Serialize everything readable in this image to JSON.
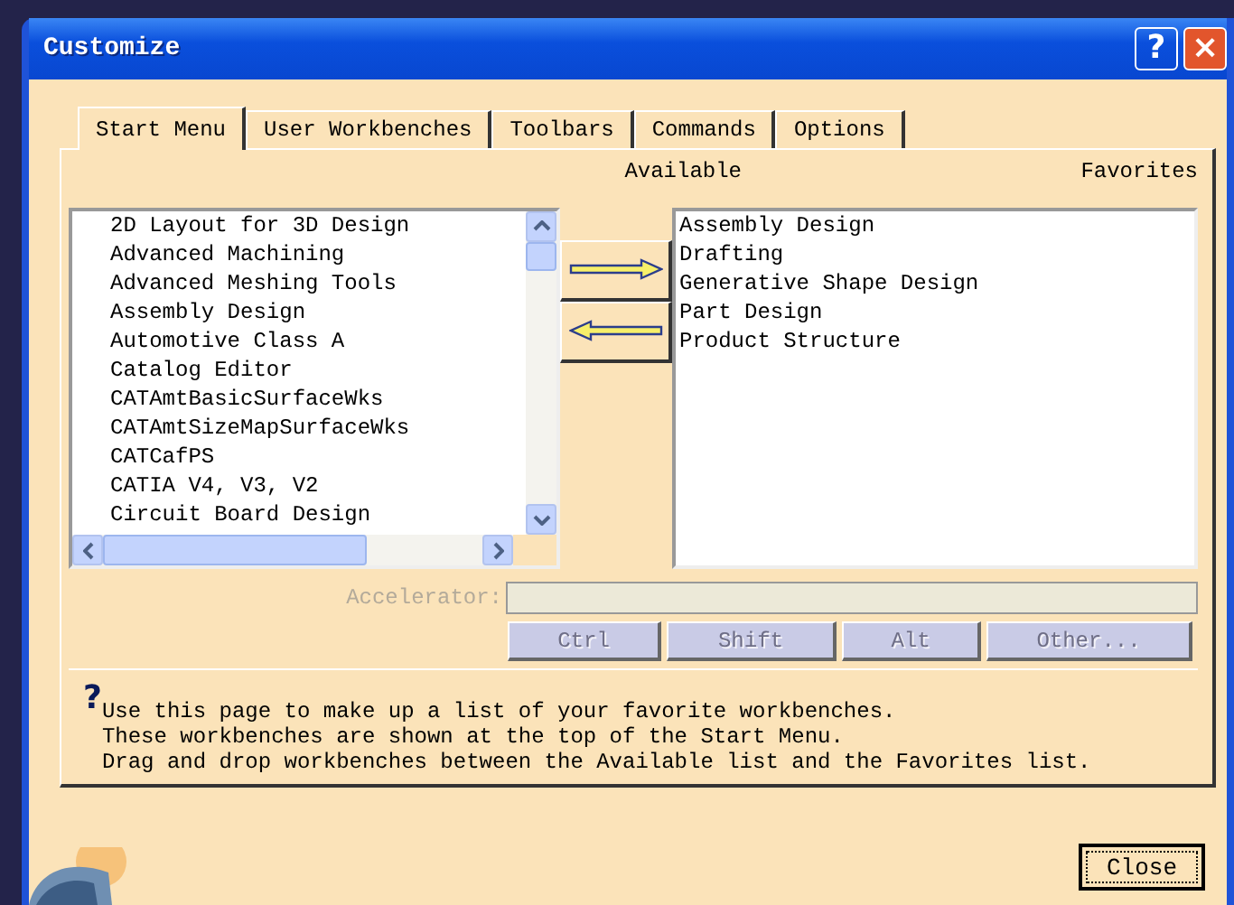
{
  "window": {
    "title": "Customize",
    "help_button": "?",
    "close_button": "×"
  },
  "tabs": [
    {
      "label": "Start Menu",
      "selected": true
    },
    {
      "label": "User Workbenches",
      "selected": false
    },
    {
      "label": "Toolbars",
      "selected": false
    },
    {
      "label": "Commands",
      "selected": false
    },
    {
      "label": "Options",
      "selected": false
    }
  ],
  "available": {
    "heading": "Available",
    "items": [
      "2D Layout for 3D Design",
      "Advanced Machining",
      "Advanced Meshing Tools",
      "Assembly Design",
      "Automotive Class A",
      "Catalog Editor",
      "CATAmtBasicSurfaceWks",
      "CATAmtSizeMapSurfaceWks",
      "CATCafPS",
      "CATIA V4, V3, V2",
      "Circuit Board Design"
    ]
  },
  "favorites": {
    "heading": "Favorites",
    "items": [
      "Assembly Design",
      "Drafting",
      "Generative Shape Design",
      "Part Design",
      "Product Structure"
    ]
  },
  "accelerator": {
    "label": "Accelerator:",
    "disabled": true,
    "buttons": [
      {
        "label": "Ctrl",
        "disabled": true
      },
      {
        "label": "Shift",
        "disabled": true
      },
      {
        "label": "Alt",
        "disabled": true
      },
      {
        "label": "Other...",
        "disabled": true
      }
    ]
  },
  "help_text": [
    "Use this page to make up a list of your favorite workbenches.",
    "These workbenches are shown at the top of the Start Menu.",
    "Drag and drop workbenches between the Available list and the Favorites list."
  ],
  "help_mark": "?",
  "close": "Close"
}
